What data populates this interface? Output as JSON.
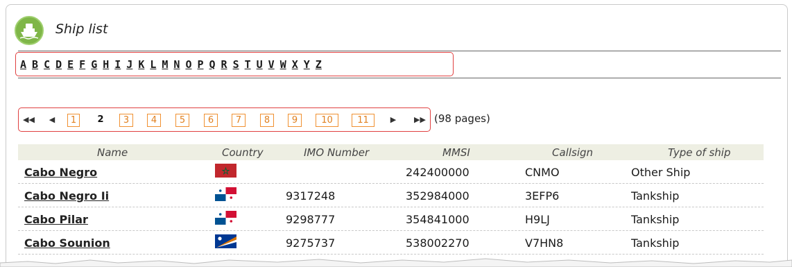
{
  "title": "Ship list",
  "alphabet": [
    "A",
    "B",
    "C",
    "D",
    "E",
    "F",
    "G",
    "H",
    "I",
    "J",
    "K",
    "L",
    "M",
    "N",
    "O",
    "P",
    "Q",
    "R",
    "S",
    "T",
    "U",
    "V",
    "W",
    "X",
    "Y",
    "Z"
  ],
  "pagination": {
    "first": "⏮",
    "prev": "◀",
    "next": "▶",
    "last": "⏭",
    "pages": [
      "1",
      "2",
      "3",
      "4",
      "5",
      "6",
      "7",
      "8",
      "9",
      "10",
      "11"
    ],
    "current": "2",
    "note": "(98 pages)"
  },
  "table": {
    "headers": {
      "name": "Name",
      "country": "Country",
      "imo": "IMO Number",
      "mmsi": "MMSI",
      "callsign": "Callsign",
      "type": "Type of ship"
    },
    "rows": [
      {
        "name": "Cabo Negro",
        "flag": "morocco",
        "imo": "",
        "mmsi": "242400000",
        "callsign": "CNMO",
        "type": "Other Ship"
      },
      {
        "name": "Cabo Negro Ii",
        "flag": "panama",
        "imo": "9317248",
        "mmsi": "352984000",
        "callsign": "3EFP6",
        "type": "Tankship"
      },
      {
        "name": "Cabo Pilar",
        "flag": "panama",
        "imo": "9298777",
        "mmsi": "354841000",
        "callsign": "H9LJ",
        "type": "Tankship"
      },
      {
        "name": "Cabo Sounion",
        "flag": "marshall-islands",
        "imo": "9275737",
        "mmsi": "538002270",
        "callsign": "V7HN8",
        "type": "Tankship"
      }
    ]
  },
  "colors": {
    "highlight_border": "#e04040",
    "page_link": "#e08020",
    "icon_green": "#7fb648",
    "header_bg": "#eeefe3"
  },
  "icons": {
    "header": "ship-icon"
  }
}
